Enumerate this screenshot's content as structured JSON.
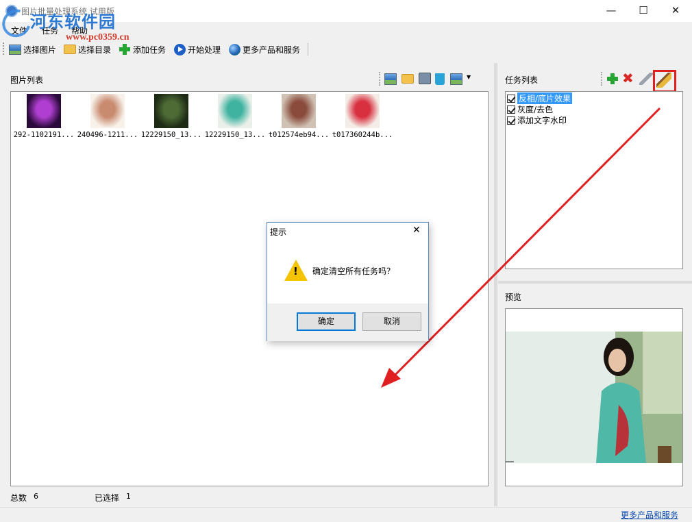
{
  "window": {
    "title": "图片批量处理系统 试用版",
    "minimize_glyph": "—",
    "maximize_glyph": "☐",
    "close_glyph": "✕"
  },
  "watermark": {
    "text": "河东软件园",
    "url": "www.pc0359.cn"
  },
  "menu": [
    "文件",
    "任务",
    "帮助"
  ],
  "toolbar": {
    "select_image": "选择图片",
    "select_dir": "选择目录",
    "add_task": "添加任务",
    "start": "开始处理",
    "more": "更多产品和服务"
  },
  "image_list": {
    "title": "图片列表",
    "items": [
      {
        "caption": "292-1102191...",
        "colors": [
          "#2a0a3a",
          "#b03fd1",
          "#f2cf6b"
        ]
      },
      {
        "caption": "240496-1211...",
        "colors": [
          "#f7f1ea",
          "#c98b70",
          "#3a2418"
        ]
      },
      {
        "caption": "12229150_13...",
        "colors": [
          "#1d2a14",
          "#4e6b36",
          "#d9b8a2"
        ]
      },
      {
        "caption": "12229150_13...",
        "colors": [
          "#e9efe9",
          "#3fb3a0",
          "#2a1d14"
        ]
      },
      {
        "caption": "t012574eb94...",
        "colors": [
          "#cfc2b4",
          "#8a4b3c",
          "#f0d9d5"
        ]
      },
      {
        "caption": "t017360244b...",
        "colors": [
          "#f4ece6",
          "#d93040",
          "#2a1a14"
        ]
      }
    ]
  },
  "task_list": {
    "title": "任务列表",
    "items": [
      {
        "label": "反相/底片效果",
        "checked": true,
        "selected": true
      },
      {
        "label": "灰度/去色",
        "checked": true,
        "selected": false
      },
      {
        "label": "添加文字水印",
        "checked": true,
        "selected": false
      }
    ]
  },
  "preview": {
    "title": "预览"
  },
  "status": {
    "total_label": "总数",
    "total_value": "6",
    "selected_label": "已选择",
    "selected_value": "1"
  },
  "footer": {
    "link": "更多产品和服务"
  },
  "dialog": {
    "title": "提示",
    "message": "确定清空所有任务吗？",
    "ok": "确定",
    "cancel": "取消",
    "close_glyph": "✕",
    "warn_glyph": "!"
  },
  "colors": {
    "annotation_red": "#e02020",
    "accent": "#0078d7",
    "selection": "#3399ff"
  }
}
